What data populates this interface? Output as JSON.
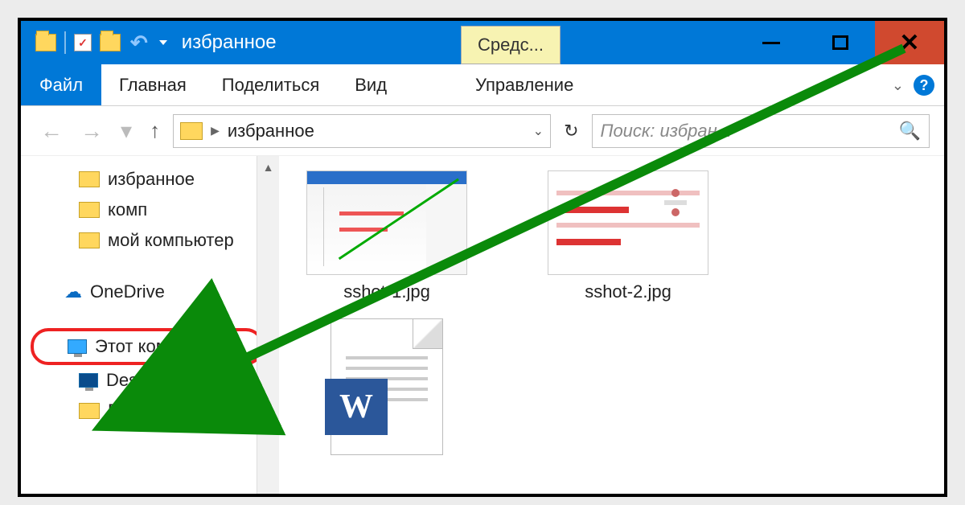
{
  "title": "избранное",
  "tool_tab": "Средс...",
  "ribbon": {
    "file": "Файл",
    "home": "Главная",
    "share": "Поделиться",
    "view": "Вид",
    "manage": "Управление"
  },
  "address": {
    "location": "избранное"
  },
  "search": {
    "placeholder": "Поиск: избран..."
  },
  "tree": {
    "fav": "избранное",
    "comp": "комп",
    "mycomp": "мой компьютер",
    "onedrive": "OneDrive",
    "thispc": "Этот компьютер",
    "desktop": "Desktop",
    "video": "Видео"
  },
  "files": {
    "f1": "sshot-1.jpg",
    "f2": "sshot-2.jpg"
  }
}
